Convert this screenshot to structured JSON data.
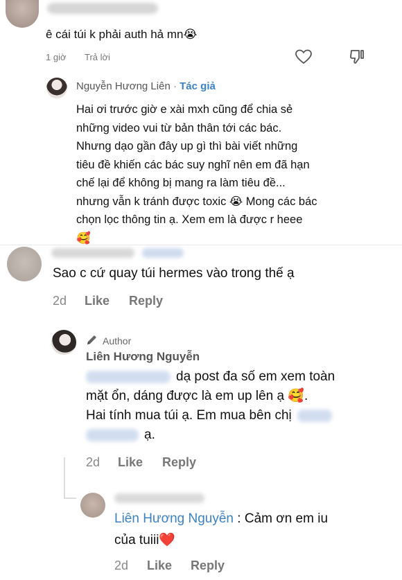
{
  "comment1": {
    "text": "ê cái túi k phải auth hả mn😭",
    "time": "1 giờ",
    "reply": "Trả lời"
  },
  "reply1": {
    "author": "Nguyễn Hương Liên",
    "separator": "·",
    "badge": "Tác giả",
    "lines": [
      "Hai ơi trước giờ e xài mxh cũng để chia sẻ",
      "những video vui từ bản thân tới các bác.",
      "Nhưng dạo gần đây up gì thì bài viết những",
      "tiêu đề khiến các bác suy nghĩ nên em đã hạn",
      "chế lại để không bị mang ra làm tiêu đề...",
      "nhưng vẫn k tránh được toxic 😭 Mong các bác",
      "chọn lọc thông tin ạ. Xem em là được r heee",
      "🥰"
    ]
  },
  "comment2": {
    "text": "Sao c cứ quay túi hermes vào trong thế ạ",
    "time": "2d",
    "like": "Like",
    "reply": "Reply"
  },
  "reply2": {
    "tag": "Author",
    "author": "Liên Hương Nguyễn",
    "line1": "dạ post đa số em xem toàn",
    "line2": "mặt ổn, dáng được là em up lên ạ 🥰.",
    "line3": "Hai tính mua túi ạ. Em mua bên chị",
    "line4": "ạ.",
    "time": "2d",
    "like": "Like",
    "reply": "Reply"
  },
  "reply3": {
    "mention": "Liên Hương Nguyễn",
    "text": " : Cảm ơn em iu",
    "text2": "của tuiii❤️",
    "time": "2d",
    "like": "Like",
    "reply": "Reply"
  }
}
